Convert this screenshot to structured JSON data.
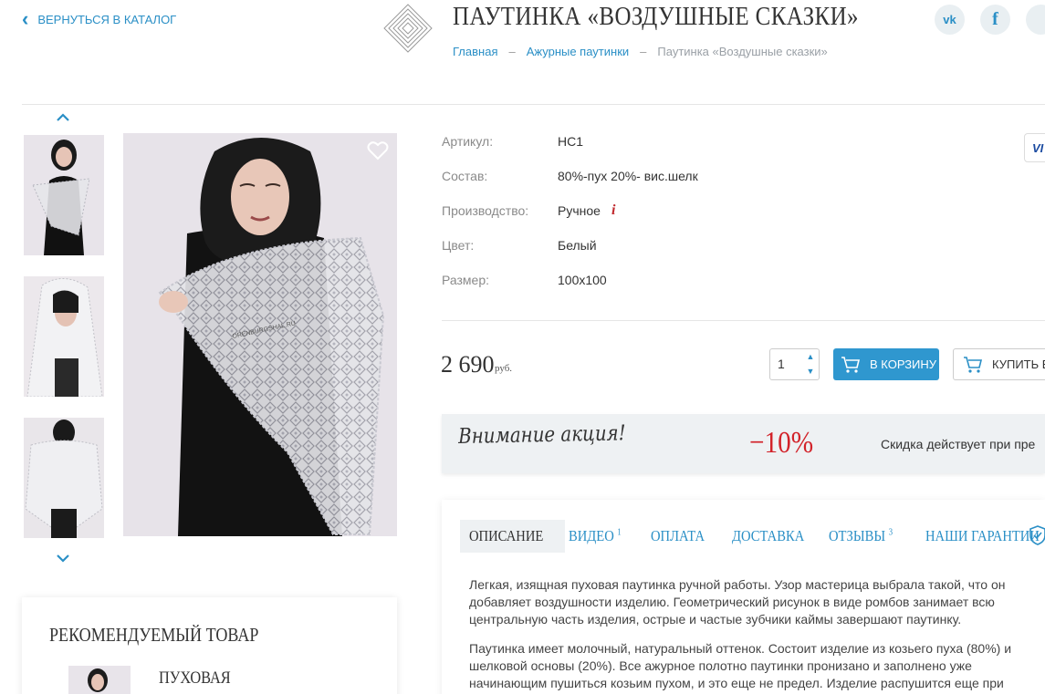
{
  "header": {
    "back_label": "ВЕРНУТЬСЯ В КАТАЛОГ",
    "title": "ПАУТИНКА «ВОЗДУШНЫЕ СКАЗКИ»",
    "breadcrumbs": {
      "home": "Главная",
      "separator": "–",
      "category": "Ажурные паутинки",
      "current": "Паутинка «Воздушные сказки»"
    },
    "social": {
      "vk": "vk",
      "fb": "f",
      "vk_icon": "vk-icon",
      "fb_icon": "facebook-icon"
    }
  },
  "gallery": {
    "up_arrow": "^",
    "down_arrow": "v",
    "thumbnails": [
      "thumbnail-1",
      "thumbnail-2",
      "thumbnail-3"
    ],
    "watermark": "ORENBURGSHAL.RU",
    "favorite_icon": "heart-icon"
  },
  "properties": [
    {
      "label": "Артикул:",
      "value": "НС1"
    },
    {
      "label": "Состав:",
      "value": "80%-пух 20%- вис.шелк"
    },
    {
      "label": "Производство:",
      "value": "Ручное"
    },
    {
      "label": "Цвет:",
      "value": "Белый"
    },
    {
      "label": "Размер:",
      "value": "100х100"
    }
  ],
  "info_marker": "i",
  "payment_badge": "VI",
  "price": {
    "amount": "2 690",
    "unit": "руб."
  },
  "purchase": {
    "quantity": "1",
    "cart_label": "В КОРЗИНУ",
    "buy_label": "КУПИТЬ В"
  },
  "promo": {
    "text": "Внимание акция!",
    "discount": "−10%",
    "note": "Скидка действует при пре"
  },
  "tabs": [
    {
      "label": "ОПИСАНИЕ",
      "sup": ""
    },
    {
      "label": "ВИДЕО",
      "sup": "1"
    },
    {
      "label": "ОПЛАТА",
      "sup": ""
    },
    {
      "label": "ДОСТАВКА",
      "sup": ""
    },
    {
      "label": "ОТЗЫВЫ",
      "sup": "3"
    },
    {
      "label": "НАШИ ГАРАНТИИ",
      "sup": ""
    }
  ],
  "description": [
    "Легкая, изящная пуховая паутинка ручной работы. Узор мастерица выбрала такой, что он",
    "добавляет воздушности изделию. Геометрический рисунок в виде ромбов занимает всю",
    "центральную часть изделия, острые и частые зубчики каймы завершают паутинку.",
    "Паутинка имеет молочный, натуральный оттенок. Состоит изделие из козьего пуха (80%) и",
    "шелковой основы (20%). Все ажурное полотно паутинки пронизано и заполнено уже",
    "начинающим пушиться козьим пухом, и это еще не предел. Изделие распушится еще при"
  ],
  "recommended": {
    "title": "РЕКОМЕНДУЕМЫЙ ТОВАР",
    "item_name": "ПУХОВАЯ"
  },
  "colors": {
    "accent": "#2a8fc6",
    "button": "#2f97cf",
    "promo_red": "#d2232a",
    "panel": "#eef1f3"
  }
}
